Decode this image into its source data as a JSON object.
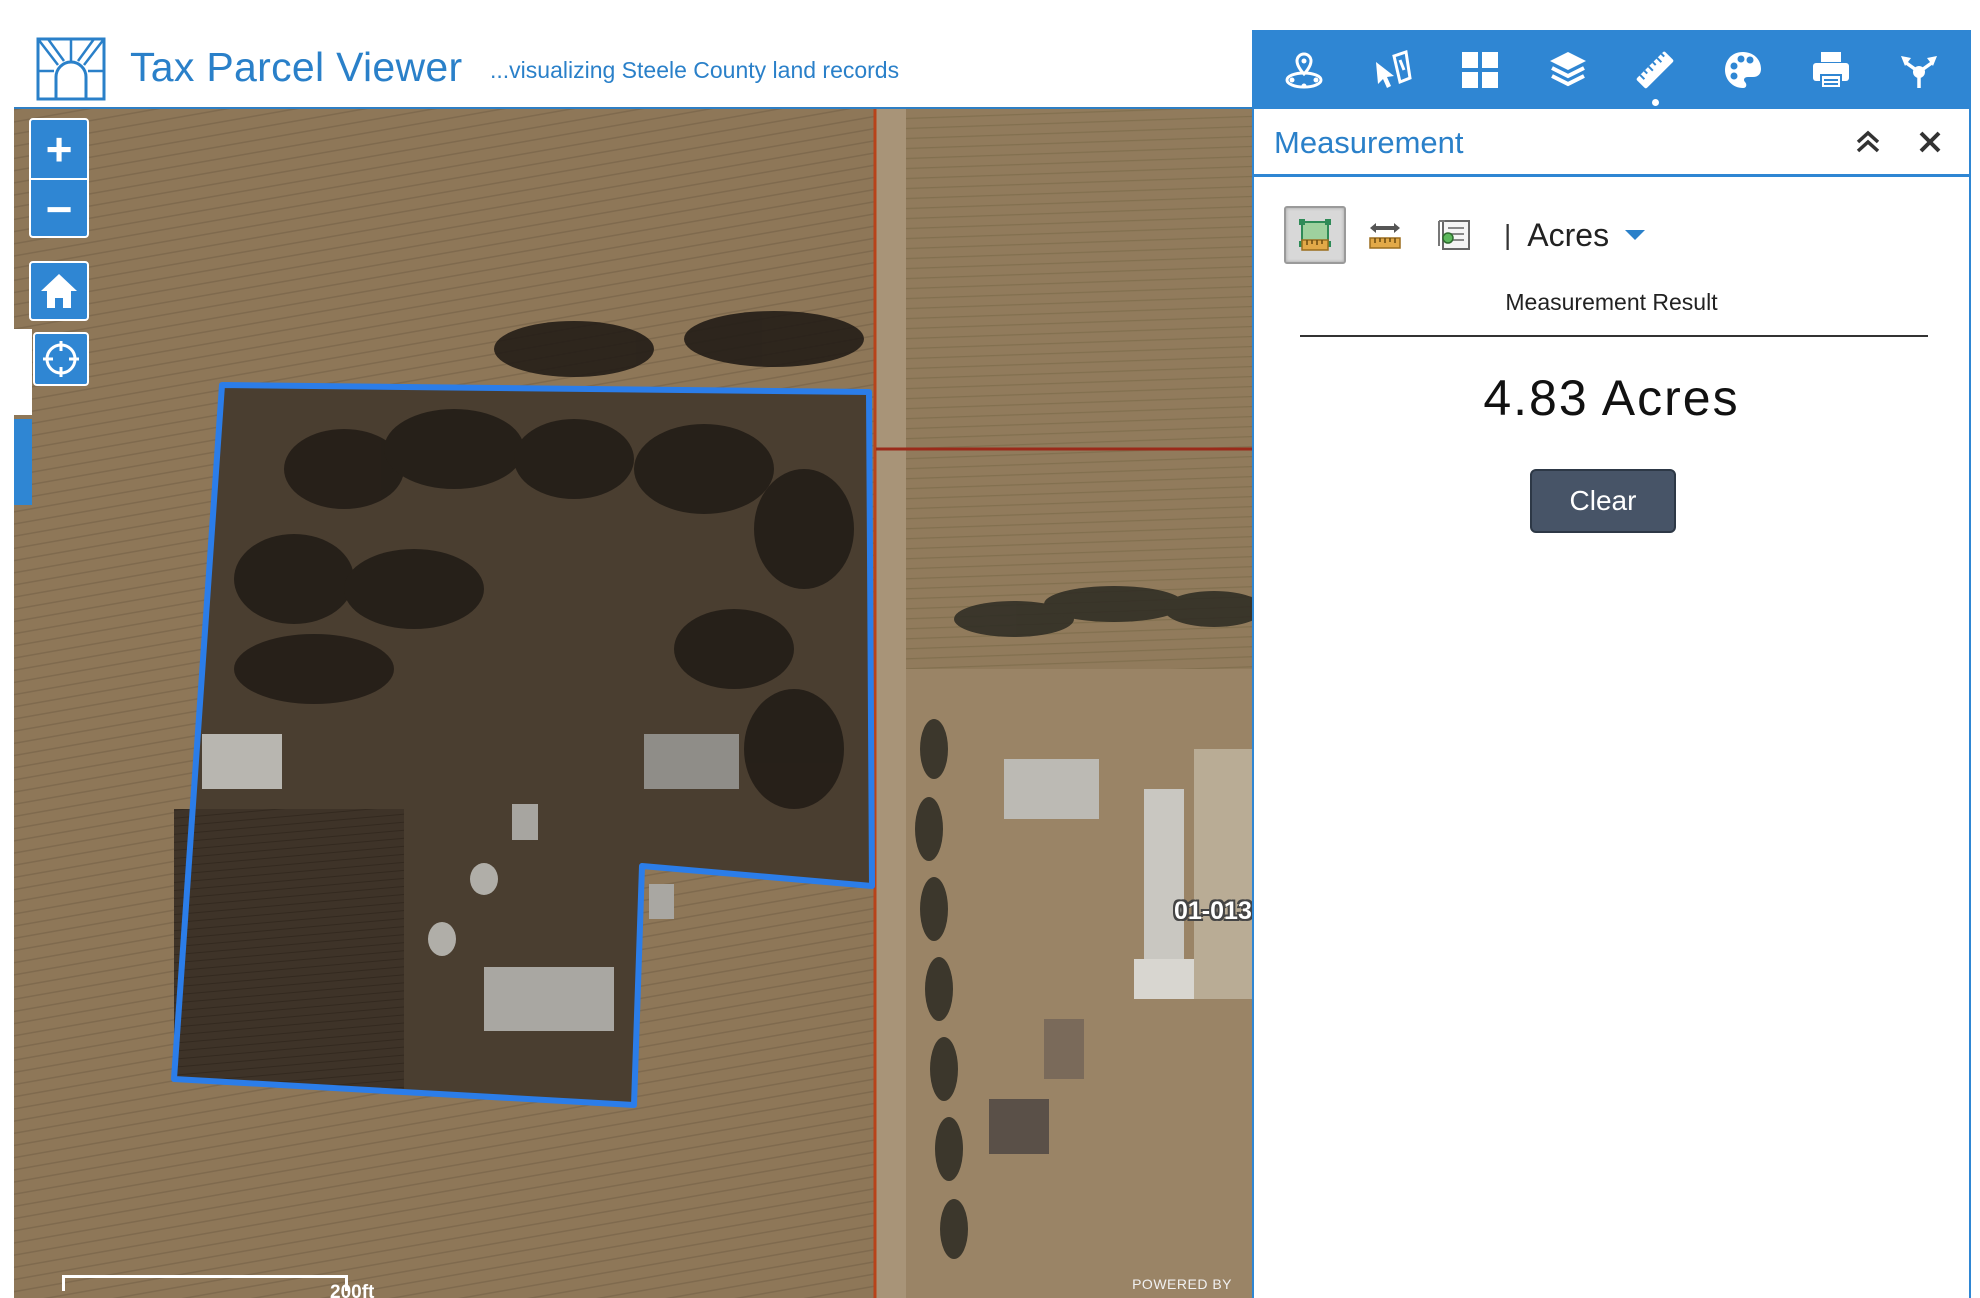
{
  "header": {
    "title": "Tax Parcel Viewer",
    "subtitle": "...visualizing Steele County land records"
  },
  "toolbar": {
    "tools": [
      {
        "name": "location-tool",
        "icon": "map-pin-icon"
      },
      {
        "name": "select-tool",
        "icon": "select-cursor-icon"
      },
      {
        "name": "widgets-tool",
        "icon": "grid-icon"
      },
      {
        "name": "layers-tool",
        "icon": "layers-icon"
      },
      {
        "name": "measurement-tool",
        "icon": "ruler-icon",
        "active": true
      },
      {
        "name": "basemap-tool",
        "icon": "palette-icon"
      },
      {
        "name": "print-tool",
        "icon": "printer-icon"
      },
      {
        "name": "share-tool",
        "icon": "share-icon"
      }
    ]
  },
  "map": {
    "zoom_in": "+",
    "zoom_out": "−",
    "parcel_label": "01-013",
    "scale_label": "200ft",
    "powered_by": "POWERED BY"
  },
  "panel": {
    "title": "Measurement",
    "unit_separator": "|",
    "unit": "Acres",
    "result_label": "Measurement Result",
    "result_value": "4.83 Acres",
    "clear_label": "Clear"
  },
  "colors": {
    "accent": "#2f86d3",
    "title_blue": "#2a80c9",
    "parcel_outline": "#2b7de9",
    "road_line": "#b8431a",
    "button_dark": "#475467"
  }
}
